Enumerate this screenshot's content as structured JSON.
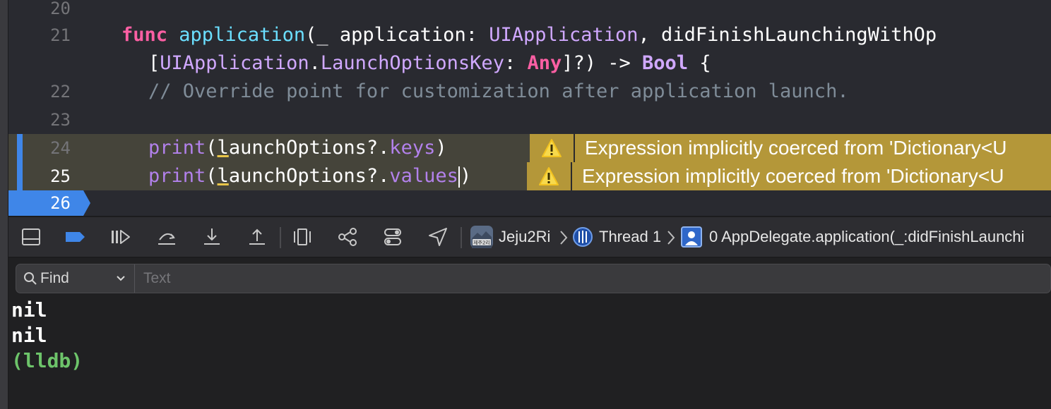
{
  "editor": {
    "lines": [
      {
        "num": "20"
      },
      {
        "num": "21"
      },
      {
        "num": "22"
      },
      {
        "num": "23"
      },
      {
        "num": "24"
      },
      {
        "num": "25"
      },
      {
        "num": "26"
      }
    ],
    "code": {
      "l21_kw": "func",
      "l21_fn": "application",
      "l21_a": "(",
      "l21_b": "_ application: ",
      "l21_t1": "UIApplication",
      "l21_c": ", didFinishLaunchingWithOp",
      "l21b_a": "[",
      "l21b_t1": "UIApplication",
      "l21b_b": ".",
      "l21b_t2": "LaunchOptionsKey",
      "l21b_c": ": ",
      "l21b_kw": "Any",
      "l21b_d": "]?) -> ",
      "l21b_t3": "Bool",
      "l21b_e": " {",
      "l22_comment": "// Override point for customization after application launch.",
      "l24_fn": "print",
      "l24_a": "(",
      "l24_u": "l",
      "l24_b": "aunchOptions?.",
      "l24_p": "keys",
      "l24_c": ")",
      "l25_fn": "print",
      "l25_a": "(",
      "l25_u": "l",
      "l25_b": "aunchOptions?.",
      "l25_p": "values",
      "l25_c": ")"
    },
    "warnings": [
      {
        "message": "Expression implicitly coerced from 'Dictionary<U"
      },
      {
        "message": "Expression implicitly coerced from 'Dictionary<U"
      }
    ]
  },
  "debugbar": {
    "icons": [
      "hide-debug-area-icon",
      "breakpoints-toggle-icon",
      "continue-icon",
      "step-over-icon",
      "step-into-icon",
      "step-out-icon",
      "view-hierarchy-icon",
      "memory-graph-icon",
      "environment-overrides-icon",
      "simulate-location-icon"
    ],
    "app_name": "Jeju2Ri",
    "thread": "Thread 1",
    "frame": "0 AppDelegate.application(_:didFinishLaunchi",
    "app_icon_text": "제주2리",
    "colors": {
      "accent": "#3f86e8",
      "warning": "#b49739"
    }
  },
  "console": {
    "filter_label": "Find",
    "text_placeholder": "Text",
    "output": [
      "nil",
      "nil",
      "(lldb)"
    ]
  }
}
